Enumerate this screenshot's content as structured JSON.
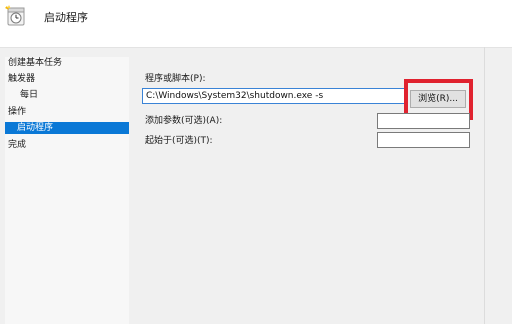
{
  "header": {
    "title": "启动程序",
    "icon": "task-wizard-icon"
  },
  "nav": {
    "items": [
      {
        "label": "创建基本任务",
        "selected": false
      },
      {
        "label": "触发器",
        "selected": false
      },
      {
        "label": "每日",
        "selected": false
      },
      {
        "label": "操作",
        "selected": false
      },
      {
        "label": "启动程序",
        "selected": true
      },
      {
        "label": "完成",
        "selected": false
      }
    ]
  },
  "form": {
    "program_label": "程序或脚本(P):",
    "program_value": "C:\\Windows\\System32\\shutdown.exe -s",
    "browse_label": "浏览(R)...",
    "args_label": "添加参数(可选)(A):",
    "args_value": "",
    "start_in_label": "起始于(可选)(T):",
    "start_in_value": ""
  },
  "colors": {
    "selection": "#0a78d6",
    "highlight": "#e0222f"
  }
}
